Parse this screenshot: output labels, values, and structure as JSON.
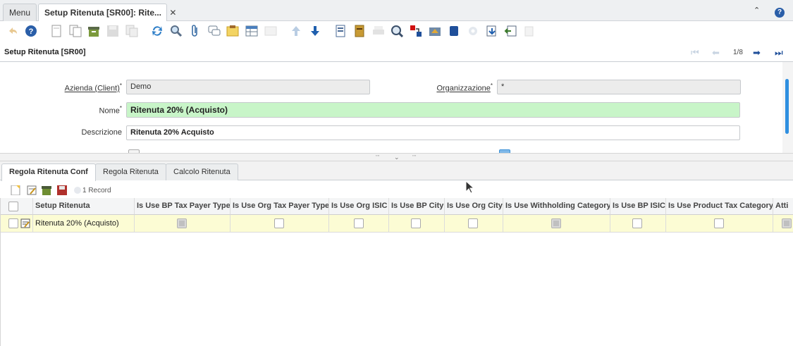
{
  "tabs": {
    "menu": "Menu",
    "window": "Setup Ritenuta [SR00]: Rite...",
    "close_icon": "close-icon"
  },
  "title": "Setup Ritenuta [SR00]",
  "record_nav": {
    "position": "1/8"
  },
  "form": {
    "client_label": "Azienda (Client)",
    "client_value": "Demo",
    "org_label": "Organizzazione",
    "org_value": "*",
    "name_label": "Nome",
    "name_value": "Ritenuta 20% (Acquisto)",
    "description_label": "Descrizione",
    "description_value": "Ritenuta 20% Acquisto",
    "required_marker": "*"
  },
  "detail_tabs": [
    "Regola Ritenuta Conf",
    "Regola Ritenuta",
    "Calcolo Ritenuta"
  ],
  "grid": {
    "record_count": "1 Record",
    "columns": [
      "Setup Ritenuta",
      "Is Use BP Tax Payer Type",
      "Is Use Org Tax Payer Type",
      "Is Use Org ISIC",
      "Is Use BP City",
      "Is Use Org City",
      "Is Use Withholding Category",
      "Is Use BP ISIC",
      "Is Use Product Tax Category",
      "Atti"
    ],
    "rows": [
      {
        "setup": "Ritenuta 20% (Acquisto)"
      }
    ]
  },
  "colors": {
    "accent": "#2a5ea8",
    "required_field": "#c8f5c8",
    "selected_row": "#fcfcd4"
  }
}
